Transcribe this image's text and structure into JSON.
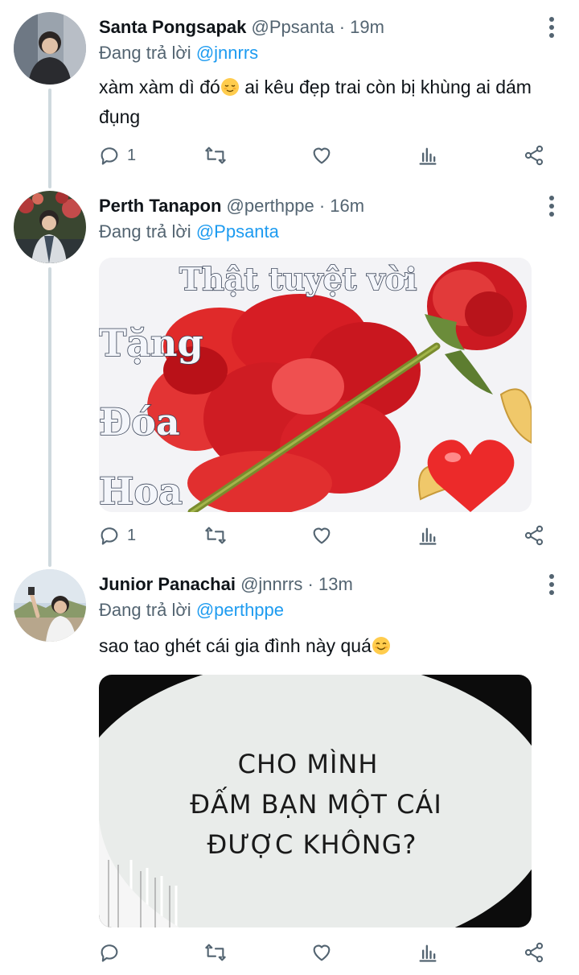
{
  "tweets": [
    {
      "name": "Santa Pongsapak",
      "handle": "@Ppsanta",
      "time": "19m",
      "reply_prefix": "Đang trả lời",
      "reply_handle": "@jnnrrs",
      "text_line1": "xàm xàm dì đó",
      "text_line1b": " ai kêu đẹp trai còn bị khùng ai dám",
      "text_line2": "đụng",
      "reply_count": "1"
    },
    {
      "name": "Perth Tanapon",
      "handle": "@perthppe",
      "time": "16m",
      "reply_prefix": "Đang trả lời",
      "reply_handle": "@Ppsanta",
      "image_text": [
        "Thật tuyệt vời",
        "Tặng",
        "Đóa",
        "Hoa"
      ],
      "reply_count": "1"
    },
    {
      "name": "Junior Panachai",
      "handle": "@jnnrrs",
      "time": "13m",
      "reply_prefix": "Đang trả lời",
      "reply_handle": "@perthppe",
      "text": "sao tao ghét cái gia đình này quá",
      "image_text": [
        "CHO MÌNH",
        "ĐẤM BẠN MỘT CÁI",
        "ĐƯỢC KHÔNG?"
      ],
      "reply_count": ""
    }
  ],
  "separator": " · ",
  "icons": [
    "reply-icon",
    "retweet-icon",
    "like-icon",
    "analytics-icon",
    "share-icon",
    "more-icon",
    "relaxed-face-emoji",
    "smiling-face-emoji"
  ],
  "colors": {
    "link": "#1d9bf0",
    "muted": "#536471",
    "thread": "#cfd9de",
    "rose": "#d91f26"
  }
}
